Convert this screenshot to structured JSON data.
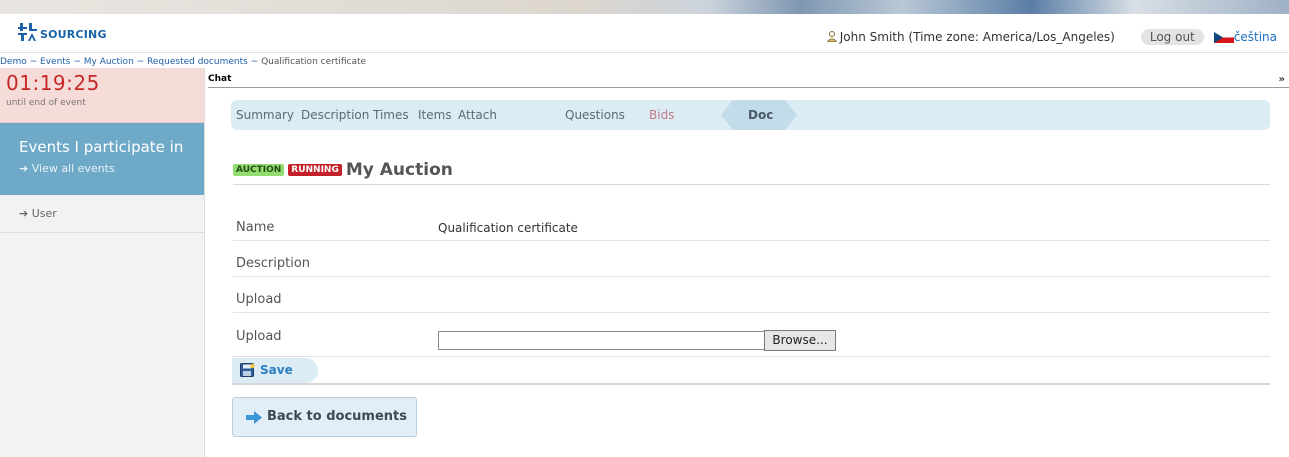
{
  "header": {
    "logo_text": "SOURCING",
    "user_text": "John Smith (Time zone: America/Los_Angeles)",
    "logout_label": "Log out",
    "language_label": "čeština"
  },
  "breadcrumb": {
    "items": [
      "Demo",
      "Events",
      "My Auction",
      "Requested documents"
    ],
    "separator": " ~ ",
    "current": "Qualification certificate"
  },
  "sidebar": {
    "timer": "01:19:25",
    "timer_caption": "until end of event",
    "events_title": "Events I participate in",
    "events_link": "View all events",
    "user_link": "User"
  },
  "chat": {
    "label": "Chat",
    "toggle": "»"
  },
  "tabs": {
    "summary": "Summary",
    "description": "Description",
    "times": "Times",
    "items": "Items",
    "attach": "Attach",
    "doc": "Doc",
    "questions": "Questions",
    "bids": "Bids"
  },
  "auction": {
    "badge_type": "AUCTION",
    "badge_status": "RUNNING",
    "title": "My Auction"
  },
  "form": {
    "name_label": "Name",
    "name_value": "Qualification certificate",
    "description_label": "Description",
    "upload_label_1": "Upload",
    "upload_label_2": "Upload",
    "browse_label": "Browse..."
  },
  "actions": {
    "save_label": "Save",
    "back_label": "Back to documents"
  },
  "colors": {
    "accent_blue": "#1a63a8",
    "events_panel": "#6ea9c7",
    "timer_red": "#c62828",
    "tab_bar": "#dcecf5",
    "badge_green": "#93dd70",
    "badge_red": "#c4222a"
  }
}
